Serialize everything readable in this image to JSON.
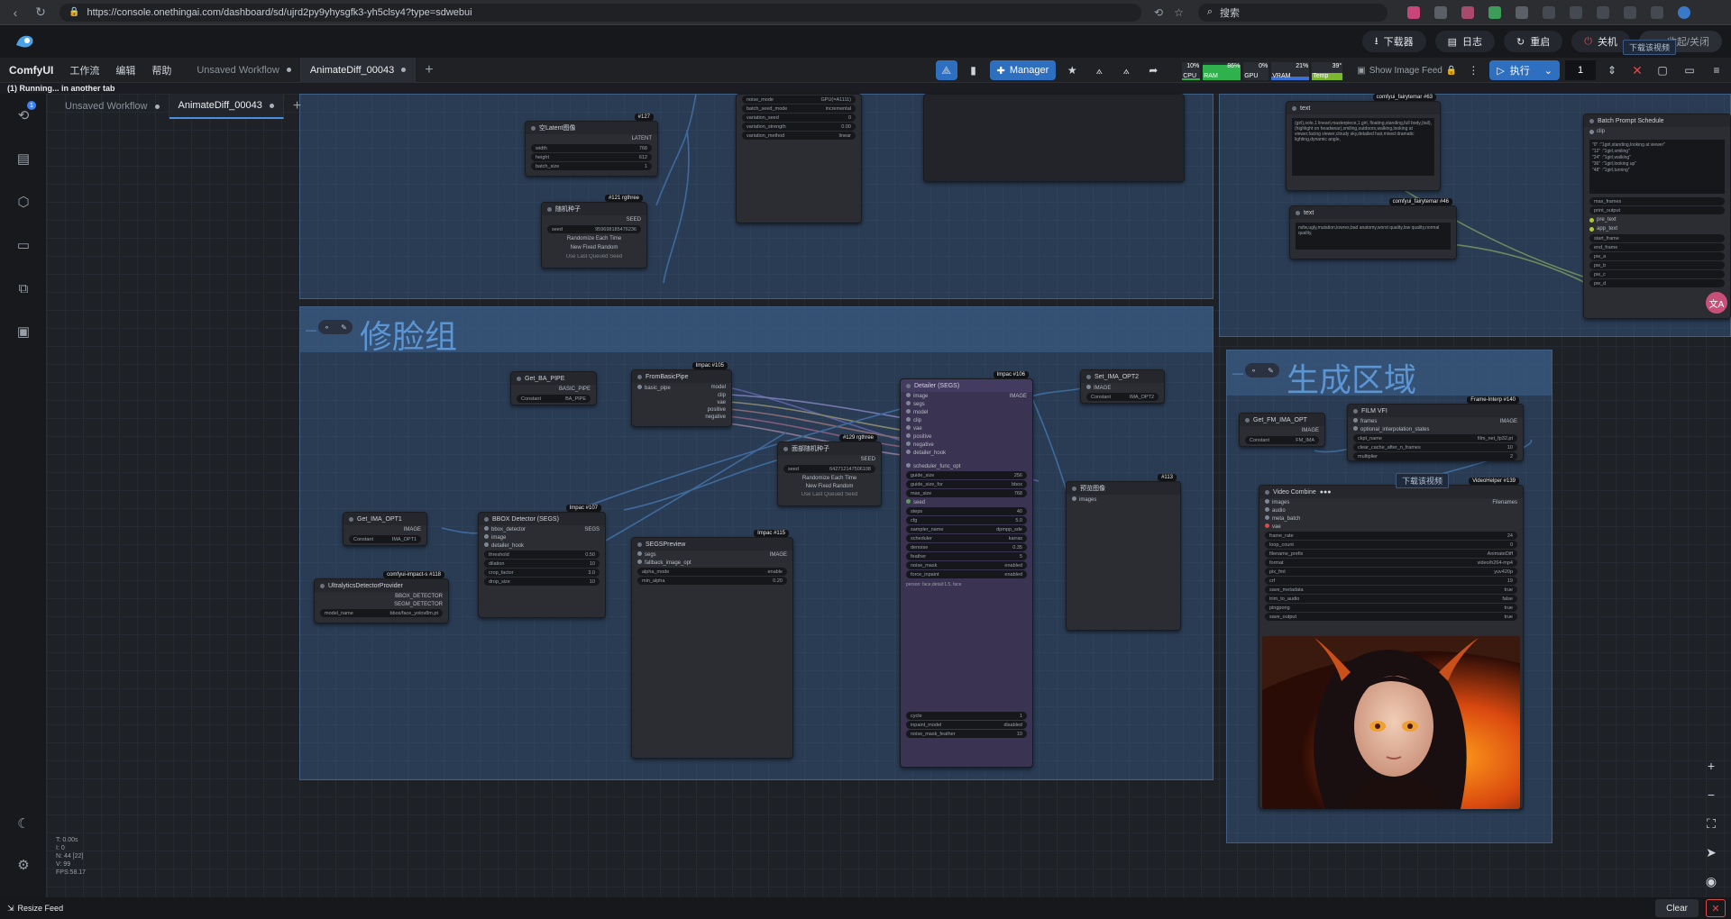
{
  "browser": {
    "url": "https://console.onethingai.com/dashboard/sd/ujrd2py9yhysgfk3-yh5clsy4?type=sdwebui",
    "search_placeholder": "搜索"
  },
  "appbar": {
    "download": "下载器",
    "logs": "日志",
    "restart": "重启",
    "shutdown": "关机",
    "collapse": "收起/关闭"
  },
  "menu": {
    "brand": "ComfyUI",
    "items": [
      "工作流",
      "编辑",
      "帮助"
    ],
    "tabs": [
      {
        "label": "Unsaved Workflow",
        "active": false
      },
      {
        "label": "AnimateDiff_00043",
        "active": true
      }
    ],
    "manager": "Manager",
    "cpu": {
      "label": "CPU",
      "pct": "10%"
    },
    "ram": {
      "label": "RAM",
      "pct": "86%"
    },
    "gpu": {
      "label": "GPU",
      "pct": "0%"
    },
    "vram": {
      "label": "VRAM",
      "pct": "21%"
    },
    "temp": {
      "label": "Temp",
      "pct": "39°"
    },
    "show_feed": "Show Image Feed",
    "run": "执行",
    "queue_count": "1"
  },
  "status_line": "(1) Running... in another tab",
  "groups": {
    "face": "修脸组",
    "gen": "生成区域"
  },
  "nodes": {
    "latent": {
      "title": "空Latent图像",
      "badge": "#127",
      "out": "LATENT",
      "w": [
        "width",
        "768"
      ],
      "h": [
        "height",
        "612"
      ],
      "b": [
        "batch_size",
        "1"
      ]
    },
    "seed": {
      "title": "随机种子",
      "badge": "#121 rgthree",
      "out": "SEED",
      "seed_val": "959698185476236",
      "btn1": "Randomize Each Time",
      "btn2": "New Fixed Random",
      "btn3": "Use Last Queued Seed"
    },
    "noise": {
      "rows": [
        [
          "noise_mode",
          "GPU(=A1111)"
        ],
        [
          "batch_seed_mode",
          "incremental"
        ],
        [
          "variation_seed",
          "0"
        ],
        [
          "variation_strength",
          "0.00"
        ],
        [
          "variation_method",
          "linear"
        ]
      ]
    },
    "text1": {
      "title": "text",
      "badge": "comfyui_fairytemar #63",
      "body": "(girl),solo,1 lineart,masterpiece,1 girl, floating,standing,full body,(tail),(highlight on headwear),smiling,outdoors,walking,looking at viewer,facing viewer,cloudy sky,detailed hair,mixed dramatic lighting,dynamic angle,"
    },
    "text2": {
      "title": "text",
      "badge": "comfyui_fairytemar #46",
      "body": "nsfw,ugly,mutation,lowres,bad anatomy,worst quality,low quality,normal quality,"
    },
    "batch": {
      "title": "Batch Prompt Schedule",
      "lines": [
        "\"0\" :\"1girl,standing,looking at viewer\"",
        "\"12\" :\"1girl,smiling\"",
        "\"24\" :\"1girl,walking\"",
        "\"36\" :\"1girl,looking up\"",
        "\"48\" :\"1girl,turning\""
      ],
      "rows": [
        "max_frames",
        "print_output",
        "pre_text",
        "app_text",
        "start_frame",
        "end_frame",
        "pw_a",
        "pw_b",
        "pw_c",
        "pw_d"
      ]
    },
    "get_pipe": {
      "title": "Get_BA_PIPE",
      "out": "BASIC_PIPE",
      "const": "BA_PIPE"
    },
    "from_pipe": {
      "title": "FromBasicPipe",
      "badge": "Impac #105",
      "in": "basic_pipe",
      "outs": [
        "model",
        "clip",
        "vae",
        "positive",
        "negative"
      ]
    },
    "detailer": {
      "title": "Detailer (SEGS)",
      "badge": "Impac #106",
      "ins": [
        "image",
        "segs",
        "model",
        "clip",
        "vae",
        "positive",
        "negative",
        "detailer_hook"
      ],
      "out": "IMAGE",
      "w": [
        [
          "guide_size",
          "256"
        ],
        [
          "guide_size_for",
          "bbox"
        ],
        [
          "max_size",
          "768"
        ],
        [
          "seed",
          ""
        ],
        [
          "steps",
          "40"
        ],
        [
          "cfg",
          "5.0"
        ],
        [
          "sampler_name",
          "dpmpp_sde"
        ],
        [
          "scheduler",
          "karras"
        ],
        [
          "denoise",
          "0.35"
        ],
        [
          "feather",
          "5"
        ],
        [
          "noise_mask",
          "enabled"
        ],
        [
          "force_inpaint",
          "enabled"
        ]
      ],
      "wl": "scheduler_func_opt",
      "wtext": "person: face,detail:1.5, face",
      "w2": [
        [
          "cycle",
          "1"
        ],
        [
          "inpaint_model",
          "disabled"
        ],
        [
          "noise_mask_feather",
          "10"
        ]
      ]
    },
    "seed2": {
      "title": "面部随机种子",
      "badge": "#129 rgthree",
      "out": "SEED",
      "seed_val": "642712147506108",
      "btn1": "Randomize Each Time",
      "btn2": "New Fixed Random",
      "btn3": "Use Last Queued Seed"
    },
    "set_ima": {
      "title": "Set_IMA_OPT2",
      "in": "IMAGE",
      "const": "IMA_OPT2"
    },
    "preview_img": {
      "title": "预览图像",
      "badge": "#113",
      "in": "images"
    },
    "get_ima": {
      "title": "Get_IMA_OPT1",
      "out": "IMAGE",
      "const": "IMA_OPT1"
    },
    "bbox": {
      "title": "BBOX Detector (SEGS)",
      "badge": "Impac #107",
      "ins": [
        "bbox_detector",
        "image",
        "detailer_hook"
      ],
      "out": "SEGS",
      "w": [
        [
          "threshold",
          "0.50"
        ],
        [
          "dilation",
          "10"
        ],
        [
          "crop_factor",
          "3.0"
        ],
        [
          "drop_size",
          "10"
        ]
      ]
    },
    "ultra": {
      "title": "UltralyticsDetectorProvider",
      "badge": "comfyui-impact-s #118",
      "outs": [
        "BBOX_DETECTOR",
        "SEGM_DETECTOR"
      ],
      "model": [
        "model_name",
        "bbox/face_yolov8m.pt"
      ]
    },
    "segs_prev": {
      "title": "SEGSPreview",
      "badge": "Impac #115",
      "ins": [
        "segs",
        "fallback_image_opt"
      ],
      "out": "IMAGE",
      "w": [
        [
          "alpha_mode",
          "enable"
        ],
        [
          "min_alpha",
          "0.20"
        ]
      ]
    },
    "get_fm": {
      "title": "Get_FM_IMA_OPT",
      "out": "IMAGE",
      "const": "FM_IMA"
    },
    "film": {
      "title": "FILM VFI",
      "badge": "Frame-Interp #140",
      "ins": [
        "frames",
        "optional_interpolation_states"
      ],
      "out": "IMAGE",
      "w": [
        [
          "ckpt_name",
          "film_net_fp32.pt"
        ],
        [
          "clear_cache_after_n_frames",
          "10"
        ],
        [
          "multiplier",
          "2"
        ]
      ]
    },
    "vcombine": {
      "title": "Video Combine",
      "badge": "VideoHelper #139",
      "ins": [
        "images",
        "audio",
        "meta_batch",
        "vae"
      ],
      "out": "Filenames",
      "w": [
        [
          "frame_rate",
          "24"
        ],
        [
          "loop_count",
          "0"
        ],
        [
          "filename_prefix",
          "AnimateDiff"
        ],
        [
          "format",
          "video/h264-mp4"
        ],
        [
          "pix_fmt",
          "yuv420p"
        ],
        [
          "crf",
          "19"
        ],
        [
          "save_metadata",
          "true"
        ],
        [
          "trim_to_audio",
          "false"
        ],
        [
          "pingpong",
          "true"
        ],
        [
          "save_output",
          "true"
        ]
      ]
    }
  },
  "download_tips": [
    "下载该视频",
    "下载该视频"
  ],
  "stats": [
    "T: 0.00s",
    "I: 0",
    "N: 44 [22]",
    "V: 99",
    "FPS:58.17"
  ],
  "bottom": {
    "resize": "Resize Feed",
    "clear": "Clear"
  }
}
